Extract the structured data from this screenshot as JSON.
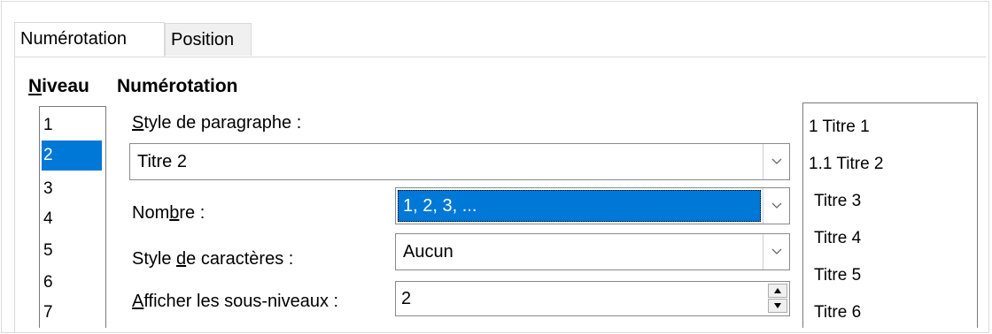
{
  "tabs": [
    {
      "label": "Numérotation",
      "active": true
    },
    {
      "label": "Position",
      "active": false
    }
  ],
  "level": {
    "heading": "Niveau",
    "heading_mnemonic": "N",
    "heading_rest": "iveau",
    "items": [
      "1",
      "2",
      "3",
      "4",
      "5",
      "6",
      "7"
    ],
    "selected": "2"
  },
  "numbering": {
    "heading": "Numérotation",
    "paragraph_style_label": "Style de paragraphe :",
    "paragraph_style_mnemonic": "S",
    "paragraph_style_rest": "tyle de paragraphe :",
    "paragraph_style_value": "Titre 2",
    "number_label": "Nombre :",
    "number_label_a": "Nom",
    "number_label_mnemonic": "b",
    "number_label_b": "re :",
    "number_value": "1, 2, 3, ...",
    "char_style_label": "Style de caractères :",
    "char_style_label_a": "Style ",
    "char_style_mnemonic": "d",
    "char_style_label_b": "e caractères :",
    "char_style_value": "Aucun",
    "sublevels_label": "Afficher les sous-niveaux :",
    "sublevels_mnemonic": "A",
    "sublevels_rest": "fficher les sous-niveaux :",
    "sublevels_value": "2"
  },
  "preview": {
    "lines": [
      "1 Titre 1",
      "1.1 Titre 2",
      "Titre 3",
      "Titre 4",
      "Titre 5",
      "Titre 6"
    ]
  },
  "colors": {
    "selection": "#0078d7",
    "border": "#8a8a8a"
  },
  "icons": {
    "dropdown": "chevron-down-icon",
    "spin_up": "triangle-up-icon",
    "spin_down": "triangle-down-icon"
  }
}
